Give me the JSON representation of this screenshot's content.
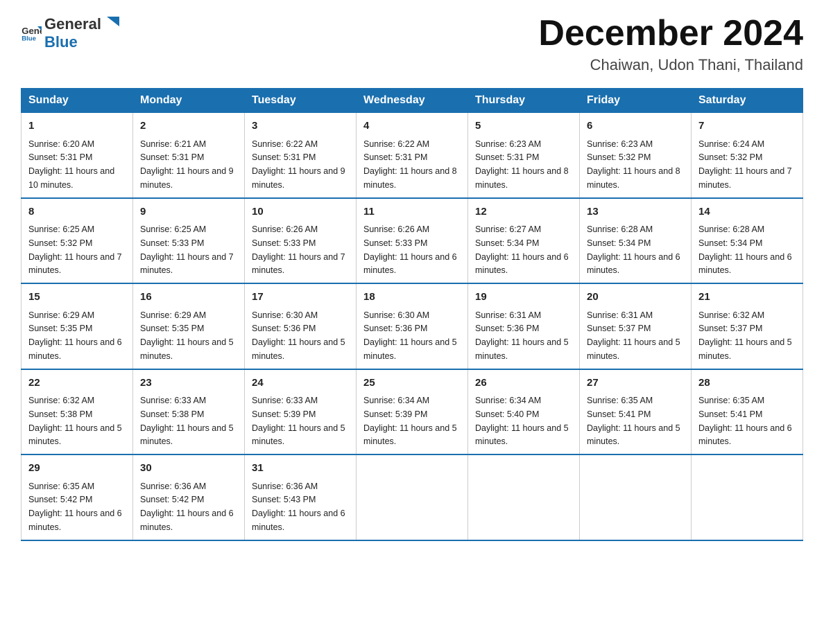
{
  "header": {
    "logo_general": "General",
    "logo_blue": "Blue",
    "month_title": "December 2024",
    "location": "Chaiwan, Udon Thani, Thailand"
  },
  "weekdays": [
    "Sunday",
    "Monday",
    "Tuesday",
    "Wednesday",
    "Thursday",
    "Friday",
    "Saturday"
  ],
  "weeks": [
    [
      {
        "day": "1",
        "sunrise": "6:20 AM",
        "sunset": "5:31 PM",
        "daylight": "11 hours and 10 minutes."
      },
      {
        "day": "2",
        "sunrise": "6:21 AM",
        "sunset": "5:31 PM",
        "daylight": "11 hours and 9 minutes."
      },
      {
        "day": "3",
        "sunrise": "6:22 AM",
        "sunset": "5:31 PM",
        "daylight": "11 hours and 9 minutes."
      },
      {
        "day": "4",
        "sunrise": "6:22 AM",
        "sunset": "5:31 PM",
        "daylight": "11 hours and 8 minutes."
      },
      {
        "day": "5",
        "sunrise": "6:23 AM",
        "sunset": "5:31 PM",
        "daylight": "11 hours and 8 minutes."
      },
      {
        "day": "6",
        "sunrise": "6:23 AM",
        "sunset": "5:32 PM",
        "daylight": "11 hours and 8 minutes."
      },
      {
        "day": "7",
        "sunrise": "6:24 AM",
        "sunset": "5:32 PM",
        "daylight": "11 hours and 7 minutes."
      }
    ],
    [
      {
        "day": "8",
        "sunrise": "6:25 AM",
        "sunset": "5:32 PM",
        "daylight": "11 hours and 7 minutes."
      },
      {
        "day": "9",
        "sunrise": "6:25 AM",
        "sunset": "5:33 PM",
        "daylight": "11 hours and 7 minutes."
      },
      {
        "day": "10",
        "sunrise": "6:26 AM",
        "sunset": "5:33 PM",
        "daylight": "11 hours and 7 minutes."
      },
      {
        "day": "11",
        "sunrise": "6:26 AM",
        "sunset": "5:33 PM",
        "daylight": "11 hours and 6 minutes."
      },
      {
        "day": "12",
        "sunrise": "6:27 AM",
        "sunset": "5:34 PM",
        "daylight": "11 hours and 6 minutes."
      },
      {
        "day": "13",
        "sunrise": "6:28 AM",
        "sunset": "5:34 PM",
        "daylight": "11 hours and 6 minutes."
      },
      {
        "day": "14",
        "sunrise": "6:28 AM",
        "sunset": "5:34 PM",
        "daylight": "11 hours and 6 minutes."
      }
    ],
    [
      {
        "day": "15",
        "sunrise": "6:29 AM",
        "sunset": "5:35 PM",
        "daylight": "11 hours and 6 minutes."
      },
      {
        "day": "16",
        "sunrise": "6:29 AM",
        "sunset": "5:35 PM",
        "daylight": "11 hours and 5 minutes."
      },
      {
        "day": "17",
        "sunrise": "6:30 AM",
        "sunset": "5:36 PM",
        "daylight": "11 hours and 5 minutes."
      },
      {
        "day": "18",
        "sunrise": "6:30 AM",
        "sunset": "5:36 PM",
        "daylight": "11 hours and 5 minutes."
      },
      {
        "day": "19",
        "sunrise": "6:31 AM",
        "sunset": "5:36 PM",
        "daylight": "11 hours and 5 minutes."
      },
      {
        "day": "20",
        "sunrise": "6:31 AM",
        "sunset": "5:37 PM",
        "daylight": "11 hours and 5 minutes."
      },
      {
        "day": "21",
        "sunrise": "6:32 AM",
        "sunset": "5:37 PM",
        "daylight": "11 hours and 5 minutes."
      }
    ],
    [
      {
        "day": "22",
        "sunrise": "6:32 AM",
        "sunset": "5:38 PM",
        "daylight": "11 hours and 5 minutes."
      },
      {
        "day": "23",
        "sunrise": "6:33 AM",
        "sunset": "5:38 PM",
        "daylight": "11 hours and 5 minutes."
      },
      {
        "day": "24",
        "sunrise": "6:33 AM",
        "sunset": "5:39 PM",
        "daylight": "11 hours and 5 minutes."
      },
      {
        "day": "25",
        "sunrise": "6:34 AM",
        "sunset": "5:39 PM",
        "daylight": "11 hours and 5 minutes."
      },
      {
        "day": "26",
        "sunrise": "6:34 AM",
        "sunset": "5:40 PM",
        "daylight": "11 hours and 5 minutes."
      },
      {
        "day": "27",
        "sunrise": "6:35 AM",
        "sunset": "5:41 PM",
        "daylight": "11 hours and 5 minutes."
      },
      {
        "day": "28",
        "sunrise": "6:35 AM",
        "sunset": "5:41 PM",
        "daylight": "11 hours and 6 minutes."
      }
    ],
    [
      {
        "day": "29",
        "sunrise": "6:35 AM",
        "sunset": "5:42 PM",
        "daylight": "11 hours and 6 minutes."
      },
      {
        "day": "30",
        "sunrise": "6:36 AM",
        "sunset": "5:42 PM",
        "daylight": "11 hours and 6 minutes."
      },
      {
        "day": "31",
        "sunrise": "6:36 AM",
        "sunset": "5:43 PM",
        "daylight": "11 hours and 6 minutes."
      },
      null,
      null,
      null,
      null
    ]
  ]
}
